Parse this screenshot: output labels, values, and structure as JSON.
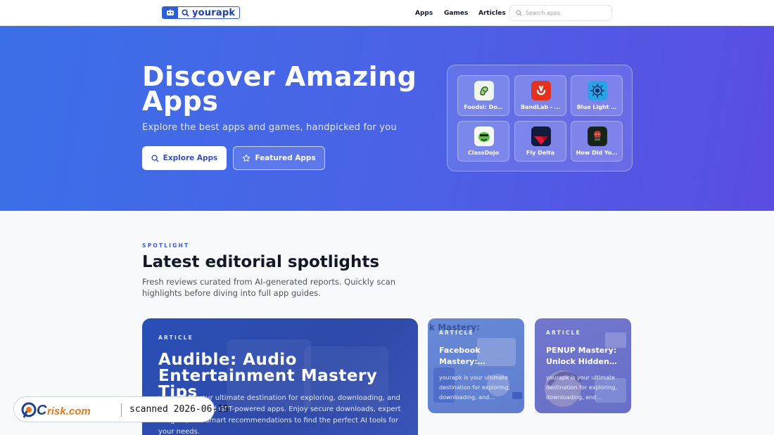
{
  "header": {
    "logo_text": "yourapk",
    "nav": {
      "apps": "Apps",
      "games": "Games",
      "articles": "Articles"
    },
    "search_placeholder": "Search apps"
  },
  "hero": {
    "title": "Discover Amazing Apps",
    "subtitle": "Explore the best apps and games, handpicked for you",
    "explore_label": "Explore Apps",
    "featured_label": "Featured Apps",
    "apps": [
      {
        "name": "Foodsi: Do…",
        "icon": "foodsi-app-icon"
      },
      {
        "name": "BandLab - …",
        "icon": "bandlab-app-icon"
      },
      {
        "name": "Blue Light …",
        "icon": "blue-light-app-icon"
      },
      {
        "name": "ClassDojo",
        "icon": "classdojo-app-icon"
      },
      {
        "name": "Fly Delta",
        "icon": "fly-delta-app-icon"
      },
      {
        "name": "How Did Yo…",
        "icon": "how-did-you-app-icon"
      }
    ]
  },
  "spotlight": {
    "eyebrow": "SPOTLIGHT",
    "title": "Latest editorial spotlights",
    "description": "Fresh reviews curated from AI-generated reports. Quickly scan highlights before diving into full app guides.",
    "cards": [
      {
        "tag": "ARTICLE",
        "title": "Audible: Audio Entertainment Mastery Tips",
        "description": "yourapk is your ultimate destination for exploring, downloading, and the latest AI and GPT-powered apps. Enjoy secure downloads, expert insights, and smart recommendations to find the perfect AI tools for your needs."
      },
      {
        "tag": "ARTICLE",
        "title": "Facebook Mastery: Essenti…",
        "description": "yourapk is your ultimate destination for exploring, downloading, and…",
        "background_text": "k Mastery:"
      },
      {
        "tag": "ARTICLE",
        "title": "PENUP Mastery: Unlock Hidden…",
        "description": "yourapk is your ultimate destination for exploring, downloading, and…"
      }
    ]
  },
  "watermark": {
    "brand": "PCrisk.com",
    "scan_text": "scanned 2026-06-19"
  },
  "colors": {
    "accent": "#3b5bdb",
    "hero_start": "#3b6fe8",
    "hero_end": "#5a4de0"
  }
}
